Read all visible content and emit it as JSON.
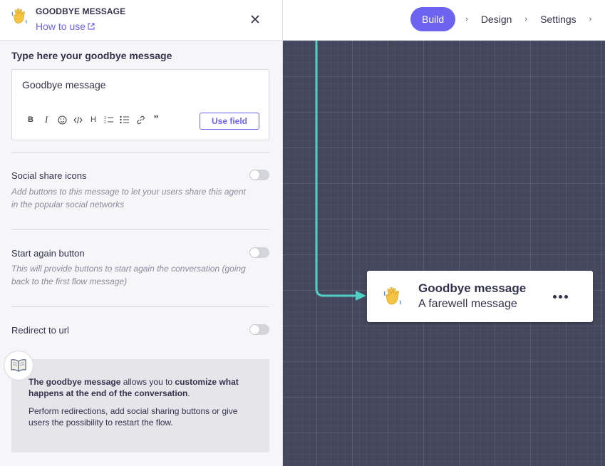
{
  "panel": {
    "title": "GOODBYE MESSAGE",
    "how_to_use": "How to use",
    "section_label": "Type here your goodbye message",
    "editor_value": "Goodbye message",
    "use_field_label": "Use field",
    "toolbar_icons": [
      "bold-icon",
      "italic-icon",
      "emoji-icon",
      "code-icon",
      "heading-icon",
      "ordered-list-icon",
      "bullet-list-icon",
      "link-icon",
      "quote-icon"
    ],
    "options": [
      {
        "title": "Social share icons",
        "desc": "Add buttons to this message to let your users share this agent in the popular social networks",
        "enabled": false
      },
      {
        "title": "Start again button",
        "desc": "This will provide buttons to start again the conversation (going back to the first flow message)",
        "enabled": false
      },
      {
        "title": "Redirect to url",
        "desc": "",
        "enabled": false
      }
    ],
    "info": {
      "p1_bold1": "The goodbye message",
      "p1_mid": " allows you to ",
      "p1_bold2": "customize what happens at the end of the conversation",
      "p1_end": ".",
      "p2": "Perform redirections, add social sharing buttons or give users the possibility to restart the flow."
    }
  },
  "nav": {
    "steps": [
      "Build",
      "Design",
      "Settings"
    ],
    "active": "Build"
  },
  "node": {
    "title": "Goodbye message",
    "subtitle": "A farewell message"
  },
  "colors": {
    "accent": "#6c63f0",
    "canvas": "#45475f",
    "connector": "#4fd1c5"
  }
}
